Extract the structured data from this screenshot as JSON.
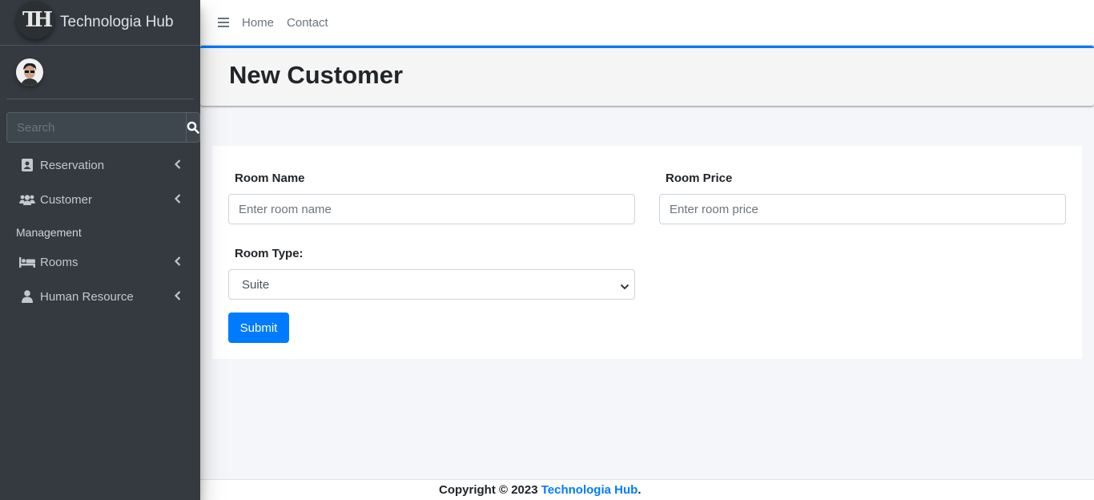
{
  "brand": {
    "logo_text": "TH",
    "name": "Technologia Hub"
  },
  "sidebar": {
    "search_placeholder": "Search",
    "items": [
      {
        "label": "Reservation",
        "icon": "contact-book-icon"
      },
      {
        "label": "Customer",
        "icon": "users-icon"
      }
    ],
    "section_header": "Management",
    "items2": [
      {
        "label": "Rooms",
        "icon": "bed-icon"
      },
      {
        "label": "Human Resource",
        "icon": "user-icon"
      }
    ]
  },
  "topbar": {
    "home": "Home",
    "contact": "Contact"
  },
  "page": {
    "title": "New Customer"
  },
  "form": {
    "room_name_label": "Room Name",
    "room_name_placeholder": "Enter room name",
    "room_price_label": "Room Price",
    "room_price_placeholder": "Enter room price",
    "room_type_label": "Room Type:",
    "room_type_selected": "Suite",
    "submit_label": "Submit"
  },
  "footer": {
    "prefix": "Copyright © 2023 ",
    "brand": "Technologia Hub",
    "suffix": "."
  },
  "colors": {
    "primary": "#007bff",
    "sidebar_bg": "#343a40"
  }
}
